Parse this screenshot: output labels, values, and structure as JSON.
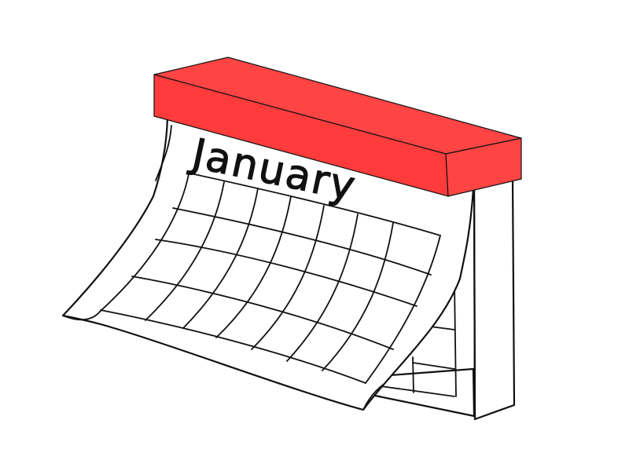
{
  "calendar": {
    "month": "January",
    "binding_color": "#ff4444",
    "binding_side_color": "#ff3b3b",
    "paper_color": "#ffffff",
    "ink_color": "#111111",
    "icon": "wall-calendar-icon"
  }
}
